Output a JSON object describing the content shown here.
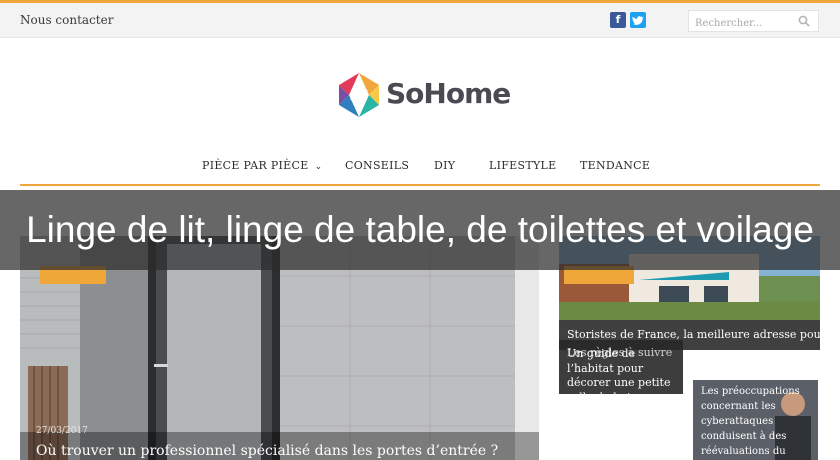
{
  "topbar": {
    "contact_label": "Nous contacter",
    "social": {
      "facebook_glyph": "f",
      "twitter_glyph": "t"
    },
    "search": {
      "placeholder": "Rechercher..."
    }
  },
  "logo": {
    "text": "SoHome"
  },
  "nav": {
    "items": [
      {
        "label": "PIÈCE PAR PIÈCE",
        "has_dropdown": true
      },
      {
        "label": "CONSEILS"
      },
      {
        "label": "DIY"
      },
      {
        "label": "LIFESTYLE"
      },
      {
        "label": "TENDANCE"
      }
    ]
  },
  "banner": {
    "title": "Linge de lit, linge de table, de toilettes et voilage"
  },
  "articles": {
    "main": {
      "date": "27/03/2017",
      "title": "Où trouver un professionnel spécialisé dans les portes d’entrée ?"
    },
    "right_top": {
      "title": "Storistes de France, la meilleure adresse pour le"
    },
    "overlap_back": {
      "title": "Les règles à suivre"
    },
    "overlap_front": {
      "title": "Un guide de l’habitat pour décorer une petite salle de bain"
    },
    "small": {
      "title": "Les préoccupations concernant les cyberattaques conduisent à des réévaluations du"
    }
  },
  "colors": {
    "accent": "#f0a73a",
    "facebook": "#3b5998",
    "twitter": "#1da1f2"
  }
}
